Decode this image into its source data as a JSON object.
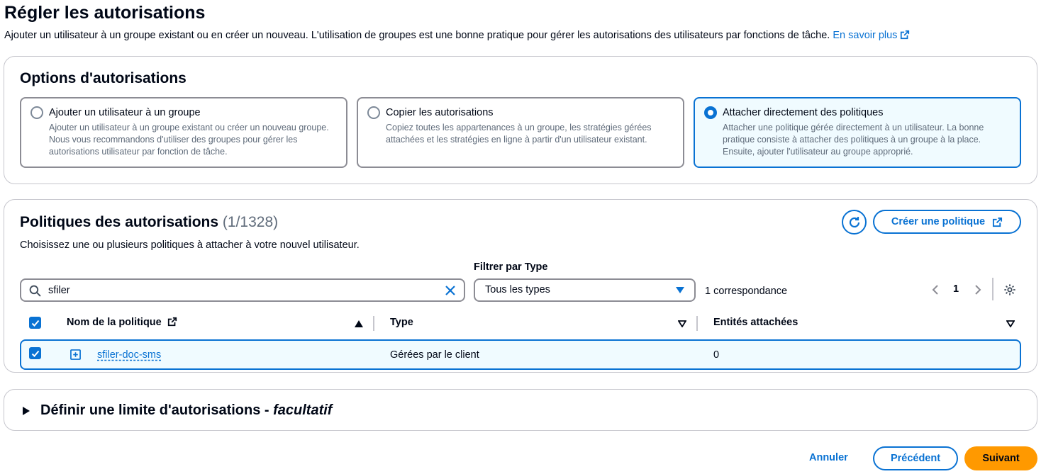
{
  "page": {
    "title": "Régler les autorisations",
    "description": "Ajouter un utilisateur à un groupe existant ou en créer un nouveau. L'utilisation de groupes est une bonne pratique pour gérer les autorisations des utilisateurs par fonctions de tâche.",
    "learn_more": "En savoir plus"
  },
  "options": {
    "title": "Options d'autorisations",
    "tiles": [
      {
        "label": "Ajouter un utilisateur à un groupe",
        "desc": "Ajouter un utilisateur à un groupe existant ou créer un nouveau groupe. Nous vous recommandons d'utiliser des groupes pour gérer les autorisations utilisateur par fonction de tâche.",
        "selected": false
      },
      {
        "label": "Copier les autorisations",
        "desc": "Copiez toutes les appartenances à un groupe, les stratégies gérées attachées et les stratégies en ligne à partir d'un utilisateur existant.",
        "selected": false
      },
      {
        "label": "Attacher directement des politiques",
        "desc": "Attacher une politique gérée directement à un utilisateur. La bonne pratique consiste à attacher des politiques à un groupe à la place. Ensuite, ajouter l'utilisateur au groupe approprié.",
        "selected": true
      }
    ]
  },
  "policies": {
    "title": "Politiques des autorisations",
    "count": "(1/1328)",
    "subtitle": "Choisissez une ou plusieurs politiques à attacher à votre nouvel utilisateur.",
    "create_button": "Créer une politique",
    "filter_label": "Filtrer par Type",
    "search_value": "sfiler",
    "filter_value": "Tous les types",
    "match_count": "1 correspondance",
    "page_number": "1",
    "columns": {
      "name": "Nom de la politique",
      "type": "Type",
      "entities": "Entités attachées"
    },
    "rows": [
      {
        "name": "sfiler-doc-sms",
        "type": "Gérées par le client",
        "entities": "0",
        "selected": true
      }
    ]
  },
  "boundary": {
    "title": "Définir une limite d'autorisations - ",
    "title_optional": "facultatif"
  },
  "footer": {
    "cancel": "Annuler",
    "previous": "Précédent",
    "next": "Suivant"
  },
  "colors": {
    "accent": "#0972d3",
    "primary_button": "#ff9900",
    "selected_bg": "#f0fbff"
  }
}
